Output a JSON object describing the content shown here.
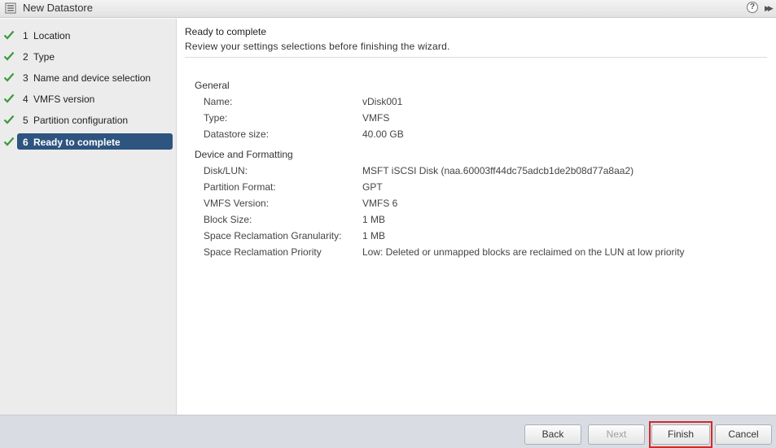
{
  "window": {
    "title": "New Datastore",
    "help_glyph": "?",
    "expand_glyph": "▶▶"
  },
  "steps": [
    {
      "num": "1",
      "label": "Location",
      "done": true
    },
    {
      "num": "2",
      "label": "Type",
      "done": true
    },
    {
      "num": "3",
      "label": "Name and device selection",
      "done": true
    },
    {
      "num": "4",
      "label": "VMFS version",
      "done": true
    },
    {
      "num": "5",
      "label": "Partition configuration",
      "done": true
    },
    {
      "num": "6",
      "label": "Ready to complete",
      "done": true,
      "active": true
    }
  ],
  "page": {
    "title": "Ready to complete",
    "subtitle": "Review your settings selections before finishing the wizard."
  },
  "general": {
    "heading": "General",
    "rows": [
      {
        "label": "Name:",
        "value": "vDisk001"
      },
      {
        "label": "Type:",
        "value": "VMFS"
      },
      {
        "label": "Datastore size:",
        "value": "40.00 GB"
      }
    ]
  },
  "device": {
    "heading": "Device and Formatting",
    "rows": [
      {
        "label": "Disk/LUN:",
        "value": "MSFT iSCSI Disk (naa.60003ff44dc75adcb1de2b08d77a8aa2)"
      },
      {
        "label": "Partition Format:",
        "value": "GPT"
      },
      {
        "label": "VMFS Version:",
        "value": "VMFS 6"
      },
      {
        "label": "Block Size:",
        "value": "1 MB"
      },
      {
        "label": "Space Reclamation Granularity:",
        "value": "1 MB"
      },
      {
        "label": "Space Reclamation Priority",
        "value": "Low: Deleted or unmapped blocks are reclaimed on the LUN at low priority"
      }
    ]
  },
  "footer": {
    "back_label": "Back",
    "next_label": "Next",
    "finish_label": "Finish",
    "cancel_label": "Cancel"
  },
  "colors": {
    "active_step": "#2e5480",
    "check": "#3a9a3a",
    "finish_highlight": "#d22a2a"
  }
}
